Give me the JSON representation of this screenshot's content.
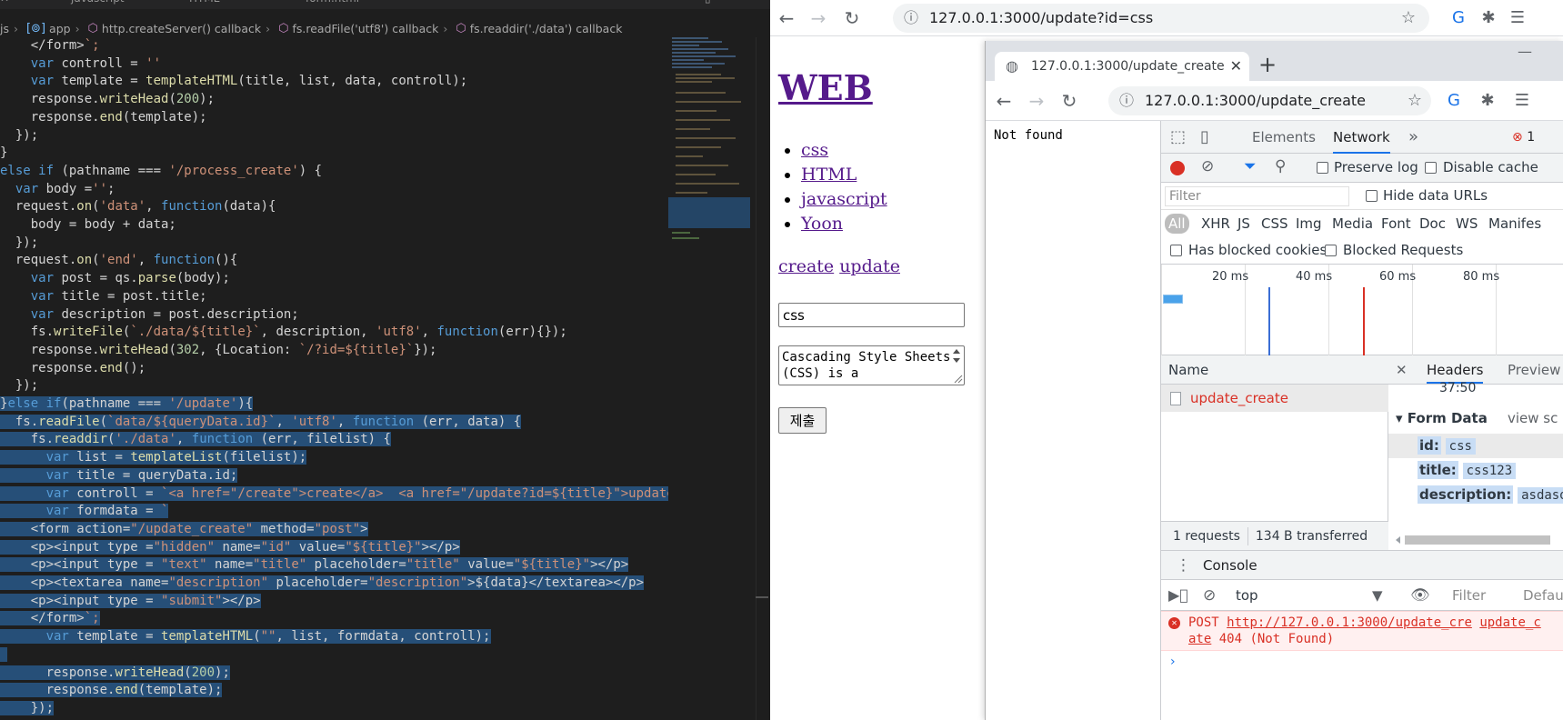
{
  "editor": {
    "tabs": [
      "javascript",
      "HTML",
      "form.html"
    ],
    "breadcrumb": [
      "js",
      "app",
      "http.createServer() callback",
      "fs.readFile('utf8') callback",
      "fs.readdir('./data') callback"
    ],
    "code_lines": [
      "    </form>`;",
      "    var controll = ''",
      "    var template = templateHTML(title, list, data, controll);",
      "    response.writeHead(200);",
      "    response.end(template);",
      "  });",
      "}",
      "else if (pathname === '/process_create') {",
      "  var body ='';",
      "  request.on('data', function(data){",
      "    body = body + data;",
      "  });",
      "  request.on('end', function(){",
      "    var post = qs.parse(body);",
      "    var title = post.title;",
      "    var description = post.description;",
      "    fs.writeFile(`./data/${title}`, description, 'utf8', function(err){});",
      "    response.writeHead(302, {Location: `/?id=${title}`});",
      "    response.end();",
      "  });",
      "}else if(pathname === '/update'){",
      "  fs.readFile(`data/${queryData.id}`, 'utf8', function (err, data) {",
      "    fs.readdir('./data', function (err, filelist) {",
      "      var list = templateList(filelist);",
      "      var title = queryData.id;",
      "      var controll = `<a href=\"/create\">create</a>  <a href=\"/update?id=${title}\">update</a",
      "      var formdata = `",
      "    <form action=\"/update_create\" method=\"post\">",
      "    <p><input type =\"hidden\" name=\"id\" value=\"${title}\"></p>",
      "    <p><input type = \"text\" name=\"title\" placeholder=\"title\" value=\"${title}\"></p>",
      "    <p><textarea name=\"description\" placeholder=\"description\">${data}</textarea></p>",
      "    <p><input type = \"submit\"></p>",
      "    </form>`;",
      "      var template = templateHTML(\"\", list, formdata, controll);",
      "",
      "      response.writeHead(200);",
      "      response.end(template);",
      "    });"
    ],
    "selected_from_line": 20
  },
  "browser": {
    "url": "127.0.0.1:3000/update?id=css",
    "page": {
      "heading": "WEB",
      "topics": [
        "css",
        "HTML",
        "javascript",
        "Yoon"
      ],
      "links": [
        "create",
        "update"
      ],
      "title_value": "css",
      "description_value": "Cascading Style Sheets (CSS) is a",
      "submit_label": "제출"
    }
  },
  "popup": {
    "tab_title": "127.0.0.1:3000/update_create",
    "url": "127.0.0.1:3000/update_create",
    "body_text": "Not found"
  },
  "devtools": {
    "tabs": [
      "Elements",
      "Network"
    ],
    "active_tab": "Network",
    "more": "»",
    "error_count": "1",
    "preserve_log": "Preserve log",
    "disable_cache": "Disable cache",
    "filter_placeholder": "Filter",
    "hide_data_urls": "Hide data URLs",
    "types": [
      "All",
      "XHR",
      "JS",
      "CSS",
      "Img",
      "Media",
      "Font",
      "Doc",
      "WS",
      "Manifes"
    ],
    "has_blocked_cookies": "Has blocked cookies",
    "blocked_requests": "Blocked Requests",
    "timeline_labels": [
      "20 ms",
      "40 ms",
      "60 ms",
      "80 ms"
    ],
    "name_header": "Name",
    "request_name": "update_create",
    "status_requests": "1 requests",
    "status_transferred": "134 B transferred",
    "headers_tab": "Headers",
    "preview_tab": "Preview",
    "cut_text": "37:50",
    "form_data_label": "Form Data",
    "view_source": "view sc",
    "form_data": [
      {
        "key": "id:",
        "value": "css"
      },
      {
        "key": "title:",
        "value": "css123"
      },
      {
        "key": "description:",
        "value": "asdasd"
      }
    ],
    "console_tab": "Console",
    "context": "top",
    "console_filter": "Filter",
    "console_default": "Defau",
    "error_line1_prefix": "POST ",
    "error_line1_link": "http://127.0.0.1:3000/update_cre",
    "error_line1_source": "update_c",
    "error_line2_link": "ate",
    "error_line2_rest": " 404 (Not Found)"
  }
}
